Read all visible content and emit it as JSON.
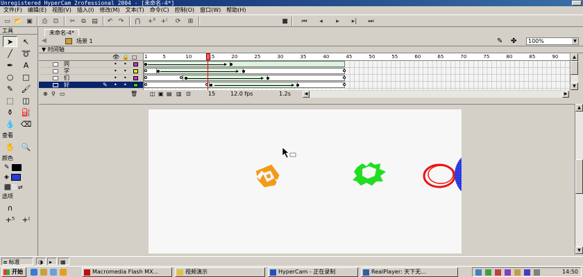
{
  "window": {
    "title": "Unregistered HyperCam 2rofessional 2004 - [未命名-4*]"
  },
  "menu": [
    "文件(F)",
    "编辑(E)",
    "视图(V)",
    "插入(I)",
    "修改(M)",
    "文本(T)",
    "命令(C)",
    "控制(O)",
    "窗口(W)",
    "帮助(H)"
  ],
  "toolbar_icons": [
    "new-icon",
    "open-icon",
    "save-icon",
    "print-icon",
    "cut-icon",
    "copy-icon",
    "paste-icon",
    "undo-icon",
    "redo-icon",
    "snap-icon",
    "smooth-icon",
    "straighten-icon",
    "rotate-icon",
    "scale-icon",
    "stop-icon",
    "rewind-icon",
    "step-back-icon",
    "play-icon",
    "step-forward-icon",
    "end-icon"
  ],
  "tools": {
    "header": "工具",
    "view_label": "查看",
    "colors_label": "颜色",
    "options_label": "选项",
    "stroke_color": "#000000",
    "fill_color": "#2a3bd6"
  },
  "document": {
    "tab": "未命名-4*",
    "scene": "场景 1",
    "zoom": "100%"
  },
  "timeline": {
    "title": "时间轴",
    "ruler_ticks": [
      "1",
      "5",
      "10",
      "15",
      "20",
      "25",
      "30",
      "35",
      "40",
      "45",
      "50",
      "55",
      "60",
      "65",
      "70",
      "75",
      "80",
      "85",
      "90"
    ],
    "layers": [
      {
        "name": "同",
        "color": "#cc33cc",
        "active": false
      },
      {
        "name": "学",
        "color": "#e8e800",
        "active": false
      },
      {
        "name": "们",
        "color": "#cc33cc",
        "active": false
      },
      {
        "name": "好",
        "color": "#33cc33",
        "active": true
      }
    ],
    "current_frame": "15",
    "fps": "12.0 fps",
    "elapsed": "1.2s"
  },
  "statusbar": {
    "mode": "标准"
  },
  "taskbar": {
    "start": "开始",
    "tasks": [
      "Macromedia Flash MX...",
      "视频演示",
      "HyperCam - 正在录制",
      "RealPlayer: 天下无..."
    ],
    "clock": "14:50"
  }
}
